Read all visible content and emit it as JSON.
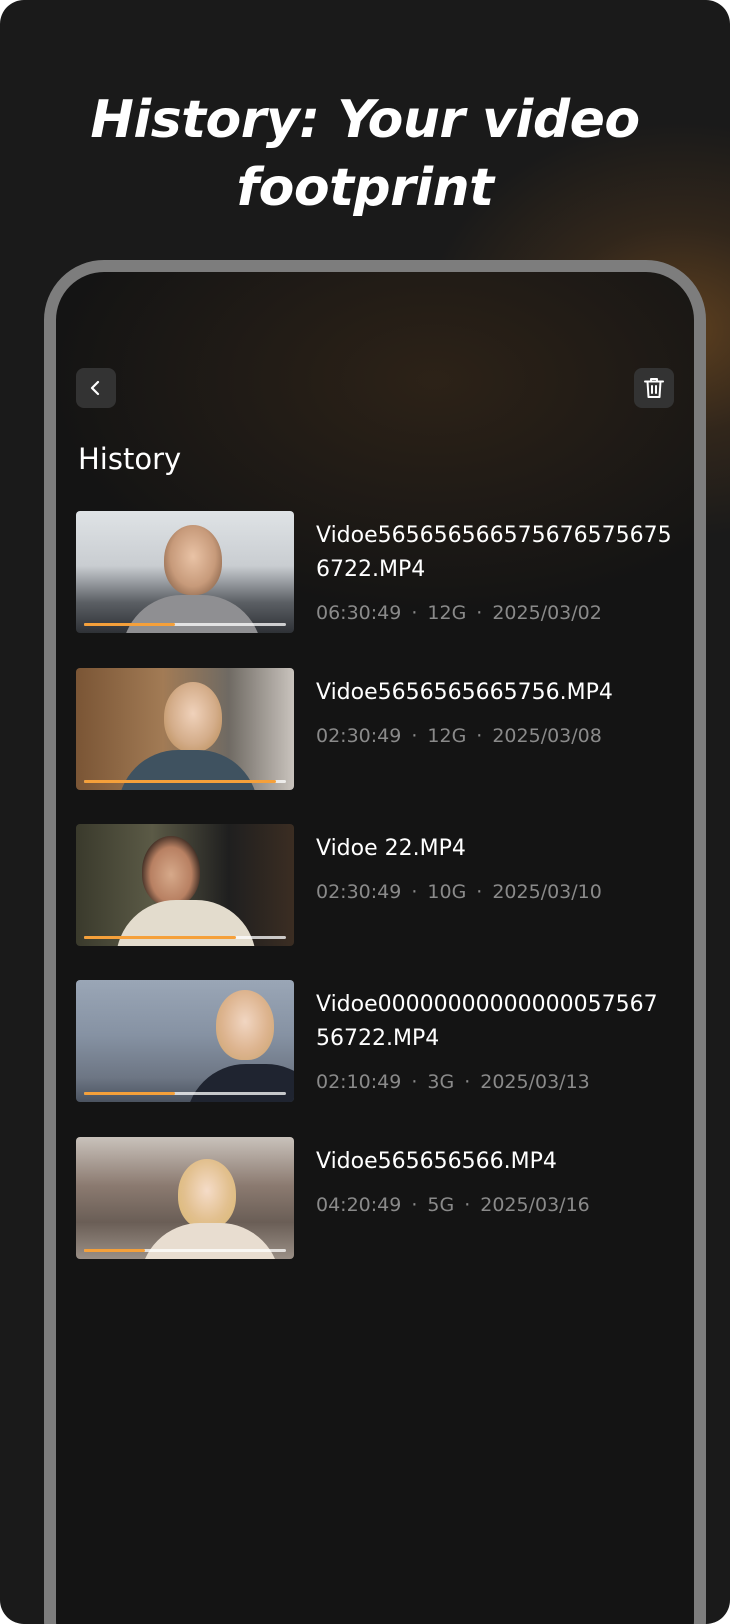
{
  "headline": {
    "line1": "History: Your video",
    "line2": "footprint"
  },
  "screen": {
    "title": "History",
    "back_icon": "chevron-left-icon",
    "delete_icon": "trash-icon"
  },
  "colors": {
    "background": "#1a1a1a",
    "progress": "#f5a03a",
    "meta_text": "#8a8a8a"
  },
  "history": [
    {
      "name": "Vidoe565656566575676575675 6722.MP4",
      "duration": "06:30:49",
      "size": "12G",
      "date": "2025/03/02",
      "progress": 0.45
    },
    {
      "name": "Vidoe5656565665756.MP4",
      "duration": "02:30:49",
      "size": "12G",
      "date": "2025/03/08",
      "progress": 0.95
    },
    {
      "name": "Vidoe 22.MP4",
      "duration": "02:30:49",
      "size": "10G",
      "date": "2025/03/10",
      "progress": 0.75
    },
    {
      "name": "Vidoe00000000000000057567 56722.MP4",
      "duration": "02:10:49",
      "size": "3G",
      "date": "2025/03/13",
      "progress": 0.45
    },
    {
      "name": "Vidoe565656566.MP4",
      "duration": "04:20:49",
      "size": "5G",
      "date": "2025/03/16",
      "progress": 0.3
    }
  ]
}
